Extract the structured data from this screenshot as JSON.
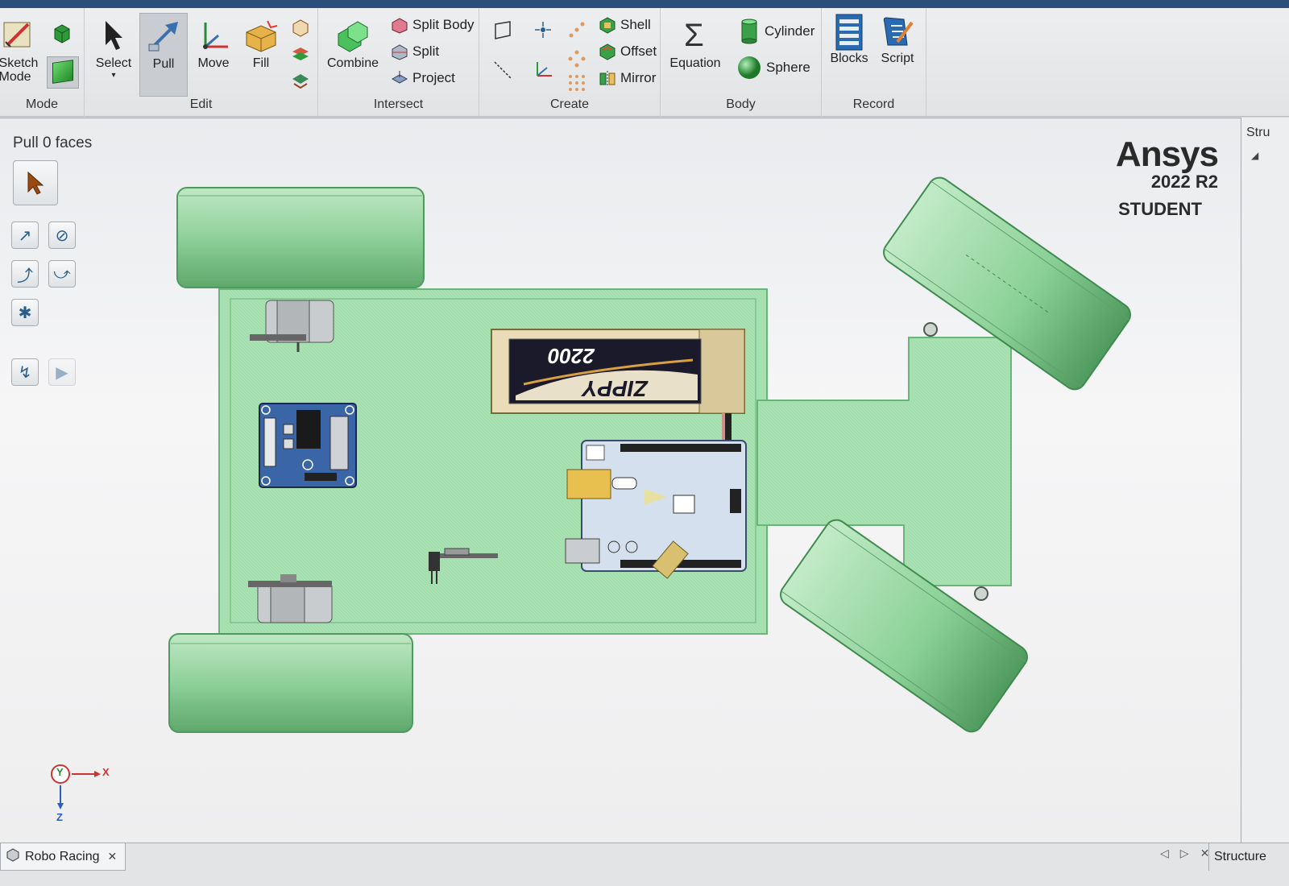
{
  "ribbon": {
    "groups": {
      "mode": "Mode",
      "edit": "Edit",
      "intersect": "Intersect",
      "create": "Create",
      "body": "Body",
      "record": "Record"
    },
    "buttons": {
      "sketch_mode": "Sketch\nMode",
      "select": "Select",
      "pull": "Pull",
      "move": "Move",
      "fill": "Fill",
      "combine": "Combine",
      "split_body": "Split Body",
      "split": "Split",
      "project": "Project",
      "shell": "Shell",
      "offset": "Offset",
      "mirror": "Mirror",
      "equation": "Equation",
      "cylinder": "Cylinder",
      "sphere": "Sphere",
      "blocks": "Blocks",
      "script": "Script"
    },
    "active_tool": "pull"
  },
  "viewport": {
    "tool_title": "Pull 0 faces",
    "brand": {
      "name": "Ansys",
      "version": "2022 R2",
      "edition": "STUDENT"
    },
    "battery_label": "2200",
    "battery_brand": "ZIPPY",
    "axis": {
      "y": "Y",
      "x": "X",
      "z": "Z"
    }
  },
  "right_panel": {
    "label": "Stru"
  },
  "bottom": {
    "document_tab": "Robo Racing",
    "structure_tab": "Structure"
  },
  "colors": {
    "body_green": "#9fdcaa",
    "body_dark": "#4f9a5e",
    "ribbon_bg": "#e6e8ea",
    "accent_blue": "#2b4f7a"
  }
}
